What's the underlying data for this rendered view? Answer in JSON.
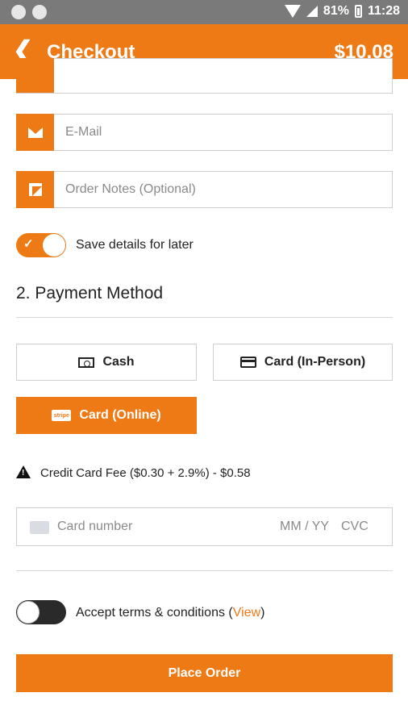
{
  "status_bar": {
    "battery": "81%",
    "time": "11:28"
  },
  "header": {
    "back_icon": "chevron-left-icon",
    "title": "Checkout",
    "total": "$10.08"
  },
  "form": {
    "email": {
      "placeholder": "E-Mail",
      "icon": "envelope-icon"
    },
    "order_notes": {
      "placeholder": "Order Notes (Optional)",
      "icon": "note-icon"
    },
    "save_details": {
      "label": "Save details for later",
      "enabled": true
    }
  },
  "payment": {
    "section_title": "2. Payment Method",
    "methods": [
      {
        "label": "Cash",
        "icon": "cash-icon",
        "selected": false
      },
      {
        "label": "Card (In-Person)",
        "icon": "credit-card-icon",
        "selected": false
      },
      {
        "label": "Card (Online)",
        "icon": "stripe-icon",
        "selected": true
      }
    ],
    "stripe_badge": "stripe",
    "fee_notice": "Credit Card Fee ($0.30 + 2.9%) - $0.58",
    "card_input": {
      "number_placeholder": "Card number",
      "expiry_placeholder": "MM / YY",
      "cvc_placeholder": "CVC"
    }
  },
  "terms": {
    "label": "Accept terms & conditions (",
    "link": "View",
    "suffix": ")",
    "enabled": false
  },
  "actions": {
    "place_order": "Place Order"
  },
  "colors": {
    "accent": "#ee7a16",
    "status_bar": "#7a7a7a"
  }
}
